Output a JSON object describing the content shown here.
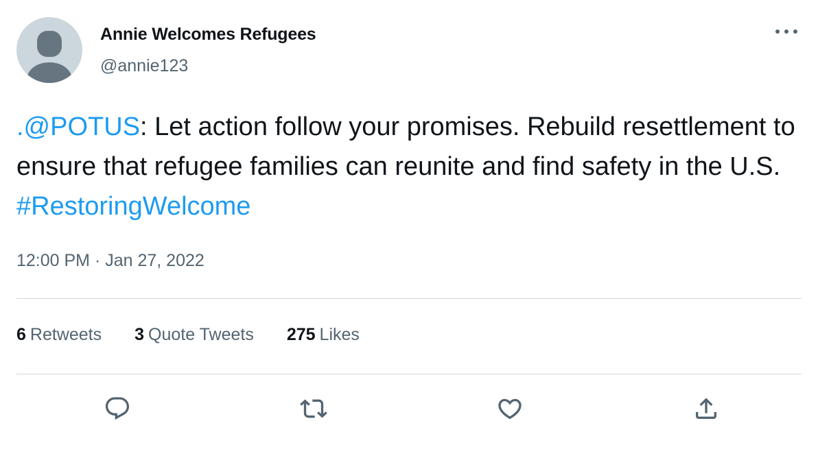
{
  "author": {
    "display_name": "Annie Welcomes Refugees",
    "handle": "@annie123",
    "avatar_icon": "default-profile-silhouette"
  },
  "tweet": {
    "mention": ".@POTUS",
    "text_part1": ": Let action follow your promises. Rebuild resettlement to ensure that refugee families can reunite and find safety in the U.S. ",
    "hashtag": "#RestoringWelcome",
    "time": "12:00 PM",
    "separator": " · ",
    "date": "Jan 27, 2022"
  },
  "stats": {
    "retweets_count": "6",
    "retweets_label": "Retweets",
    "quote_tweets_count": "3",
    "quote_tweets_label": "Quote Tweets",
    "likes_count": "275",
    "likes_label": "Likes"
  },
  "actions": [
    {
      "name": "reply",
      "icon": "reply-icon"
    },
    {
      "name": "retweet",
      "icon": "retweet-icon"
    },
    {
      "name": "like",
      "icon": "heart-icon"
    },
    {
      "name": "share",
      "icon": "share-icon"
    }
  ],
  "colors": {
    "link": "#1d9bf0",
    "text_primary": "#0f1419",
    "text_secondary": "#536471",
    "divider": "#cfd9de",
    "avatar_bg": "#ccd6dd",
    "avatar_fg": "#66757f"
  }
}
